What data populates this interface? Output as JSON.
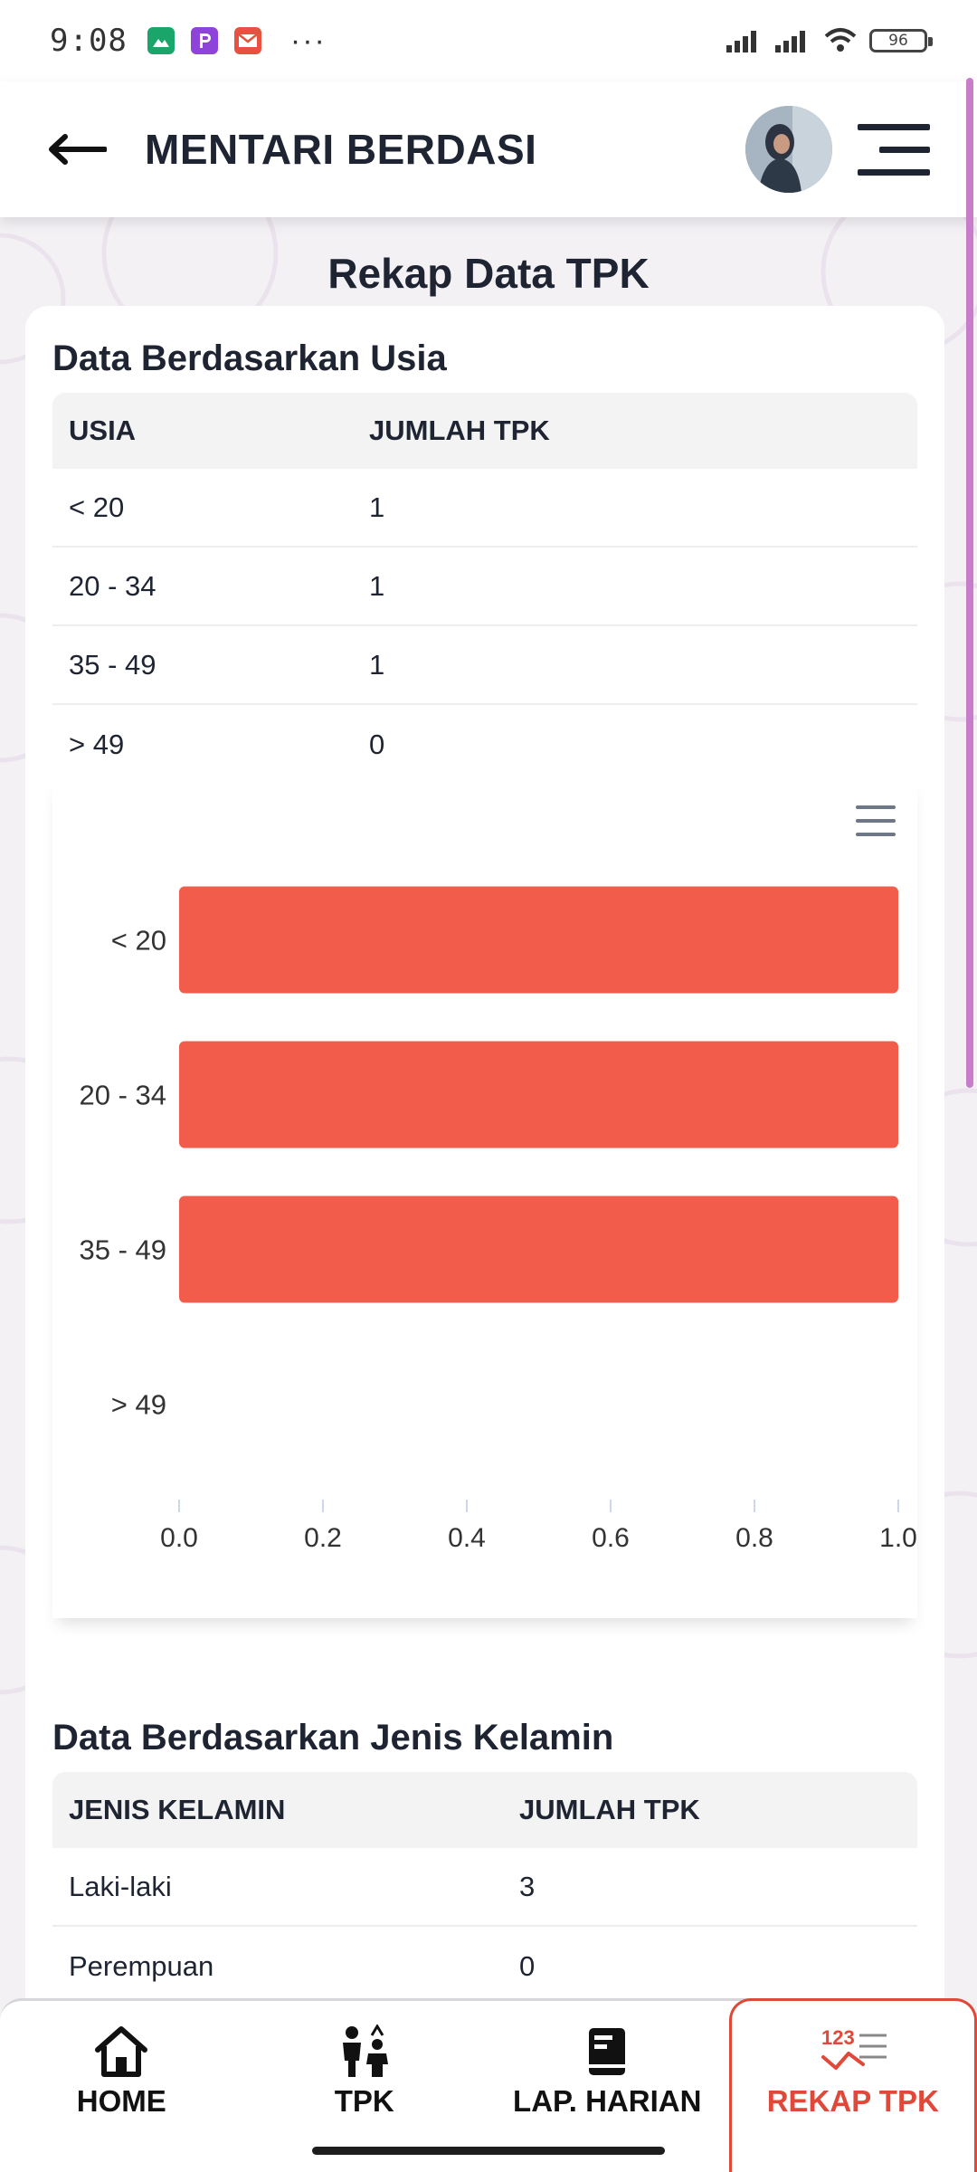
{
  "status": {
    "time": "9:08",
    "more": "···",
    "battery": "96"
  },
  "header": {
    "title": "MENTARI BERDASI"
  },
  "page": {
    "title": "Rekap Data TPK"
  },
  "age_section": {
    "title": "Data Berdasarkan Usia",
    "columns": [
      "USIA",
      "JUMLAH TPK"
    ],
    "rows": [
      {
        "label": "< 20",
        "value": "1"
      },
      {
        "label": "20 - 34",
        "value": "1"
      },
      {
        "label": "35 - 49",
        "value": "1"
      },
      {
        "label": "> 49",
        "value": "0"
      }
    ]
  },
  "chart_data": {
    "type": "bar",
    "orientation": "horizontal",
    "categories": [
      "< 20",
      "20 - 34",
      "35 - 49",
      "> 49"
    ],
    "values": [
      1,
      1,
      1,
      0
    ],
    "xlim": [
      0,
      1
    ],
    "xticks": [
      "0.0",
      "0.2",
      "0.4",
      "0.6",
      "0.8",
      "1.0"
    ],
    "bar_color": "#f15d4a",
    "grid": false
  },
  "gender_section": {
    "title": "Data Berdasarkan Jenis Kelamin",
    "columns": [
      "JENIS KELAMIN",
      "JUMLAH TPK"
    ],
    "rows": [
      {
        "label": "Laki-laki",
        "value": "3"
      },
      {
        "label": "Perempuan",
        "value": "0"
      }
    ]
  },
  "bottom_nav": {
    "items": [
      {
        "label": "HOME",
        "icon": "home-icon"
      },
      {
        "label": "TPK",
        "icon": "family-icon"
      },
      {
        "label": "LAP. HARIAN",
        "icon": "report-icon"
      },
      {
        "label": "REKAP TPK",
        "icon": "chart-list-icon"
      }
    ],
    "active": "REKAP TPK"
  },
  "colors": {
    "accent": "#e0483a",
    "scroll": "#c77dc9"
  }
}
